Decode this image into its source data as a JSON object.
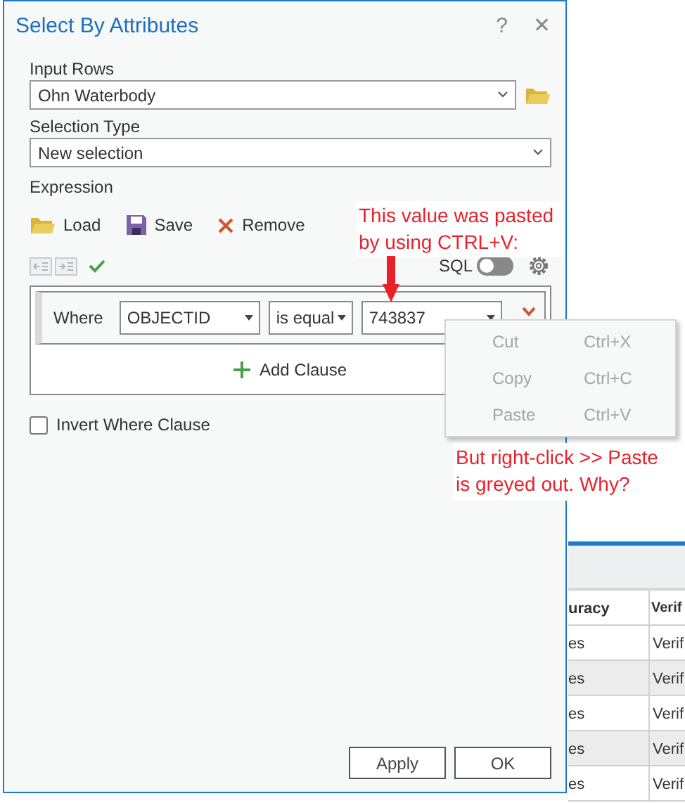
{
  "dialog": {
    "title": "Select By Attributes",
    "help": "?",
    "close": "✕",
    "input_rows": {
      "label": "Input Rows",
      "value": "Ohn Waterbody"
    },
    "selection_type": {
      "label": "Selection Type",
      "value": "New selection"
    },
    "expression": {
      "label": "Expression",
      "actions": [
        {
          "kind": "load",
          "label": "Load"
        },
        {
          "kind": "save",
          "label": "Save"
        },
        {
          "kind": "remove",
          "label": "Remove"
        }
      ],
      "sql_label": "SQL",
      "sql_on": false,
      "clause": {
        "where": "Where",
        "field": "OBJECTID",
        "operator": "is equal",
        "value": "743837"
      },
      "add_clause": "Add Clause"
    },
    "invert": {
      "label": "Invert Where Clause",
      "checked": false
    },
    "buttons": [
      "Apply",
      "OK"
    ]
  },
  "context_menu": [
    {
      "label": "Cut",
      "shortcut": "Ctrl+X",
      "disabled": true
    },
    {
      "label": "Copy",
      "shortcut": "Ctrl+C",
      "disabled": true
    },
    {
      "label": "Paste",
      "shortcut": "Ctrl+V",
      "disabled": true
    }
  ],
  "annotations": [
    {
      "text": "This value was pasted by using CTRL+V:"
    },
    {
      "text": "But right-click >> Paste is greyed out. Why?"
    }
  ],
  "background_table": {
    "columns": [
      "uracy",
      "Verif"
    ],
    "rows": [
      [
        "es",
        "Verif"
      ],
      [
        "es",
        "Verif"
      ],
      [
        "es",
        "Verif"
      ],
      [
        "es",
        "Verif"
      ],
      [
        "es",
        "Verif"
      ]
    ]
  }
}
